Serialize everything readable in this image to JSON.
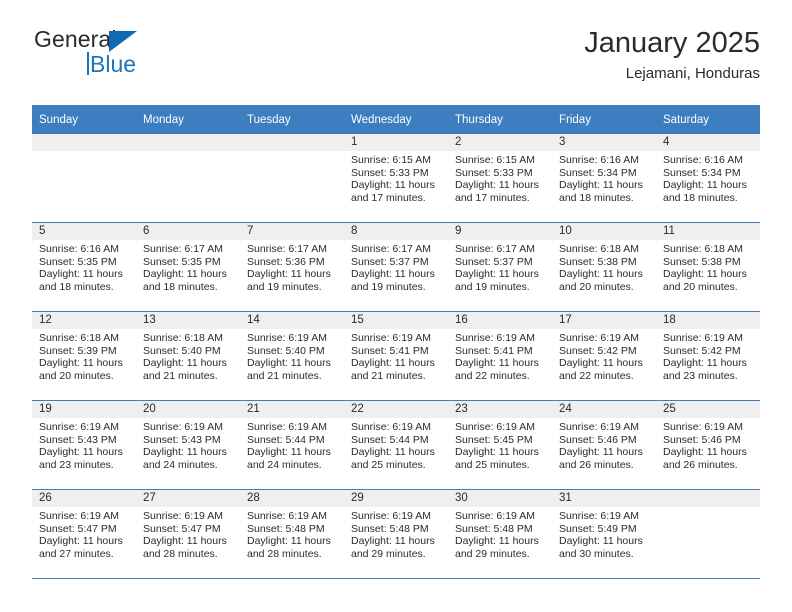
{
  "brand": {
    "name_top": "General",
    "name_bottom": "Blue",
    "triangle_icon": "triangle-icon",
    "color_blue": "#1b75bc"
  },
  "header": {
    "title": "January 2025",
    "subtitle": "Lejamani, Honduras"
  },
  "theme": {
    "header_blue": "#3c7ebf",
    "daynum_band": "#efefef",
    "text": "#2b2b2b"
  },
  "weekday_headers": [
    "Sunday",
    "Monday",
    "Tuesday",
    "Wednesday",
    "Thursday",
    "Friday",
    "Saturday"
  ],
  "labels": {
    "sunrise_prefix": "Sunrise:",
    "sunset_prefix": "Sunset:",
    "daylight_prefix": "Daylight:"
  },
  "weeks": [
    [
      {
        "empty": true,
        "day": ""
      },
      {
        "empty": true,
        "day": ""
      },
      {
        "empty": true,
        "day": ""
      },
      {
        "day": "1",
        "sunrise": "Sunrise: 6:15 AM",
        "sunset": "Sunset: 5:33 PM",
        "daylight_1": "Daylight: 11 hours",
        "daylight_2": "and 17 minutes."
      },
      {
        "day": "2",
        "sunrise": "Sunrise: 6:15 AM",
        "sunset": "Sunset: 5:33 PM",
        "daylight_1": "Daylight: 11 hours",
        "daylight_2": "and 17 minutes."
      },
      {
        "day": "3",
        "sunrise": "Sunrise: 6:16 AM",
        "sunset": "Sunset: 5:34 PM",
        "daylight_1": "Daylight: 11 hours",
        "daylight_2": "and 18 minutes."
      },
      {
        "day": "4",
        "sunrise": "Sunrise: 6:16 AM",
        "sunset": "Sunset: 5:34 PM",
        "daylight_1": "Daylight: 11 hours",
        "daylight_2": "and 18 minutes."
      }
    ],
    [
      {
        "day": "5",
        "sunrise": "Sunrise: 6:16 AM",
        "sunset": "Sunset: 5:35 PM",
        "daylight_1": "Daylight: 11 hours",
        "daylight_2": "and 18 minutes."
      },
      {
        "day": "6",
        "sunrise": "Sunrise: 6:17 AM",
        "sunset": "Sunset: 5:35 PM",
        "daylight_1": "Daylight: 11 hours",
        "daylight_2": "and 18 minutes."
      },
      {
        "day": "7",
        "sunrise": "Sunrise: 6:17 AM",
        "sunset": "Sunset: 5:36 PM",
        "daylight_1": "Daylight: 11 hours",
        "daylight_2": "and 19 minutes."
      },
      {
        "day": "8",
        "sunrise": "Sunrise: 6:17 AM",
        "sunset": "Sunset: 5:37 PM",
        "daylight_1": "Daylight: 11 hours",
        "daylight_2": "and 19 minutes."
      },
      {
        "day": "9",
        "sunrise": "Sunrise: 6:17 AM",
        "sunset": "Sunset: 5:37 PM",
        "daylight_1": "Daylight: 11 hours",
        "daylight_2": "and 19 minutes."
      },
      {
        "day": "10",
        "sunrise": "Sunrise: 6:18 AM",
        "sunset": "Sunset: 5:38 PM",
        "daylight_1": "Daylight: 11 hours",
        "daylight_2": "and 20 minutes."
      },
      {
        "day": "11",
        "sunrise": "Sunrise: 6:18 AM",
        "sunset": "Sunset: 5:38 PM",
        "daylight_1": "Daylight: 11 hours",
        "daylight_2": "and 20 minutes."
      }
    ],
    [
      {
        "day": "12",
        "sunrise": "Sunrise: 6:18 AM",
        "sunset": "Sunset: 5:39 PM",
        "daylight_1": "Daylight: 11 hours",
        "daylight_2": "and 20 minutes."
      },
      {
        "day": "13",
        "sunrise": "Sunrise: 6:18 AM",
        "sunset": "Sunset: 5:40 PM",
        "daylight_1": "Daylight: 11 hours",
        "daylight_2": "and 21 minutes."
      },
      {
        "day": "14",
        "sunrise": "Sunrise: 6:19 AM",
        "sunset": "Sunset: 5:40 PM",
        "daylight_1": "Daylight: 11 hours",
        "daylight_2": "and 21 minutes."
      },
      {
        "day": "15",
        "sunrise": "Sunrise: 6:19 AM",
        "sunset": "Sunset: 5:41 PM",
        "daylight_1": "Daylight: 11 hours",
        "daylight_2": "and 21 minutes."
      },
      {
        "day": "16",
        "sunrise": "Sunrise: 6:19 AM",
        "sunset": "Sunset: 5:41 PM",
        "daylight_1": "Daylight: 11 hours",
        "daylight_2": "and 22 minutes."
      },
      {
        "day": "17",
        "sunrise": "Sunrise: 6:19 AM",
        "sunset": "Sunset: 5:42 PM",
        "daylight_1": "Daylight: 11 hours",
        "daylight_2": "and 22 minutes."
      },
      {
        "day": "18",
        "sunrise": "Sunrise: 6:19 AM",
        "sunset": "Sunset: 5:42 PM",
        "daylight_1": "Daylight: 11 hours",
        "daylight_2": "and 23 minutes."
      }
    ],
    [
      {
        "day": "19",
        "sunrise": "Sunrise: 6:19 AM",
        "sunset": "Sunset: 5:43 PM",
        "daylight_1": "Daylight: 11 hours",
        "daylight_2": "and 23 minutes."
      },
      {
        "day": "20",
        "sunrise": "Sunrise: 6:19 AM",
        "sunset": "Sunset: 5:43 PM",
        "daylight_1": "Daylight: 11 hours",
        "daylight_2": "and 24 minutes."
      },
      {
        "day": "21",
        "sunrise": "Sunrise: 6:19 AM",
        "sunset": "Sunset: 5:44 PM",
        "daylight_1": "Daylight: 11 hours",
        "daylight_2": "and 24 minutes."
      },
      {
        "day": "22",
        "sunrise": "Sunrise: 6:19 AM",
        "sunset": "Sunset: 5:44 PM",
        "daylight_1": "Daylight: 11 hours",
        "daylight_2": "and 25 minutes."
      },
      {
        "day": "23",
        "sunrise": "Sunrise: 6:19 AM",
        "sunset": "Sunset: 5:45 PM",
        "daylight_1": "Daylight: 11 hours",
        "daylight_2": "and 25 minutes."
      },
      {
        "day": "24",
        "sunrise": "Sunrise: 6:19 AM",
        "sunset": "Sunset: 5:46 PM",
        "daylight_1": "Daylight: 11 hours",
        "daylight_2": "and 26 minutes."
      },
      {
        "day": "25",
        "sunrise": "Sunrise: 6:19 AM",
        "sunset": "Sunset: 5:46 PM",
        "daylight_1": "Daylight: 11 hours",
        "daylight_2": "and 26 minutes."
      }
    ],
    [
      {
        "day": "26",
        "sunrise": "Sunrise: 6:19 AM",
        "sunset": "Sunset: 5:47 PM",
        "daylight_1": "Daylight: 11 hours",
        "daylight_2": "and 27 minutes."
      },
      {
        "day": "27",
        "sunrise": "Sunrise: 6:19 AM",
        "sunset": "Sunset: 5:47 PM",
        "daylight_1": "Daylight: 11 hours",
        "daylight_2": "and 28 minutes."
      },
      {
        "day": "28",
        "sunrise": "Sunrise: 6:19 AM",
        "sunset": "Sunset: 5:48 PM",
        "daylight_1": "Daylight: 11 hours",
        "daylight_2": "and 28 minutes."
      },
      {
        "day": "29",
        "sunrise": "Sunrise: 6:19 AM",
        "sunset": "Sunset: 5:48 PM",
        "daylight_1": "Daylight: 11 hours",
        "daylight_2": "and 29 minutes."
      },
      {
        "day": "30",
        "sunrise": "Sunrise: 6:19 AM",
        "sunset": "Sunset: 5:48 PM",
        "daylight_1": "Daylight: 11 hours",
        "daylight_2": "and 29 minutes."
      },
      {
        "day": "31",
        "sunrise": "Sunrise: 6:19 AM",
        "sunset": "Sunset: 5:49 PM",
        "daylight_1": "Daylight: 11 hours",
        "daylight_2": "and 30 minutes."
      },
      {
        "empty": true,
        "day": ""
      }
    ]
  ]
}
